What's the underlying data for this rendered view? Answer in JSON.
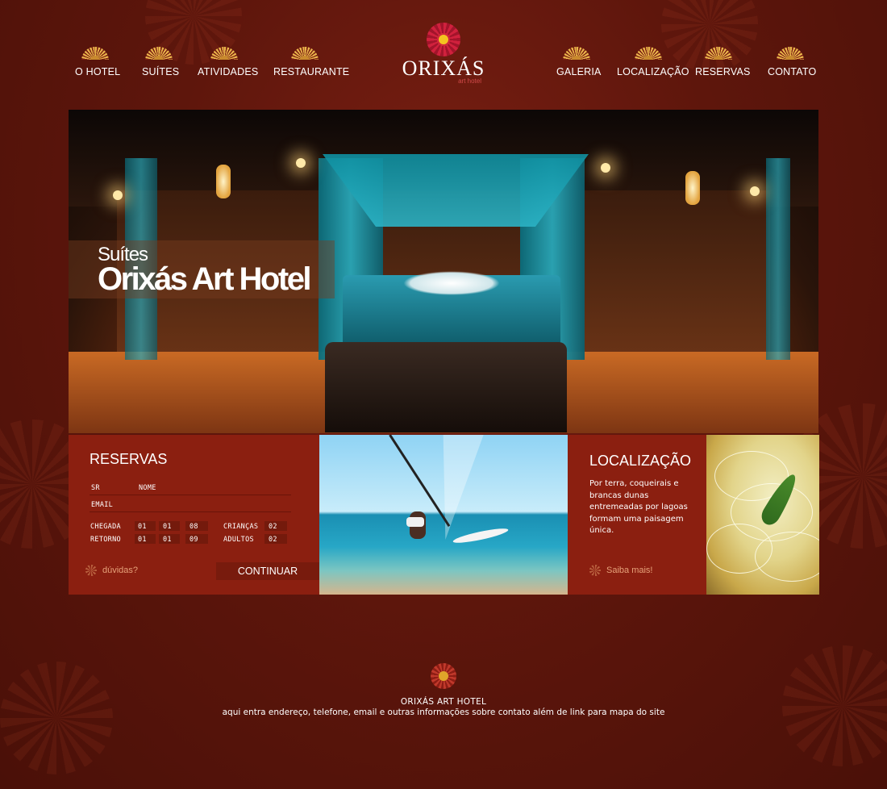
{
  "nav": {
    "left": [
      "O HOTEL",
      "SUÍTES",
      "ATIVIDADES",
      "RESTAURANTE"
    ],
    "right": [
      "GALERIA",
      "LOCALIZAÇÃO",
      "RESERVAS",
      "CONTATO"
    ]
  },
  "logo": {
    "name": "ORIXÁS",
    "sub": "art hotel"
  },
  "hero": {
    "small": "Suítes",
    "big": "Orixás Art Hotel"
  },
  "reservas": {
    "title": "RESERVAS",
    "sr": "SR",
    "nome": "NOME",
    "email": "EMAIL",
    "chegada": "CHEGADA",
    "retorno": "RETORNO",
    "chegada_vals": [
      "01",
      "01",
      "08"
    ],
    "retorno_vals": [
      "01",
      "01",
      "09"
    ],
    "criancas": "CRIANÇAS",
    "criancas_val": "02",
    "adultos": "ADULTOS",
    "adultos_val": "02",
    "duvidas": "dúvidas?",
    "continuar": "CONTINUAR"
  },
  "localizacao": {
    "title": "LOCALIZAÇÃO",
    "text": "Por terra, coqueirais e brancas dunas entremeadas por lagoas formam uma paisagem única.",
    "saiba": "Saiba mais!"
  },
  "footer": {
    "title": "ORIXÁS ART HOTEL",
    "text": "aqui entra endereço, telefone, email e outras informações sobre contato além de link para mapa do site"
  }
}
